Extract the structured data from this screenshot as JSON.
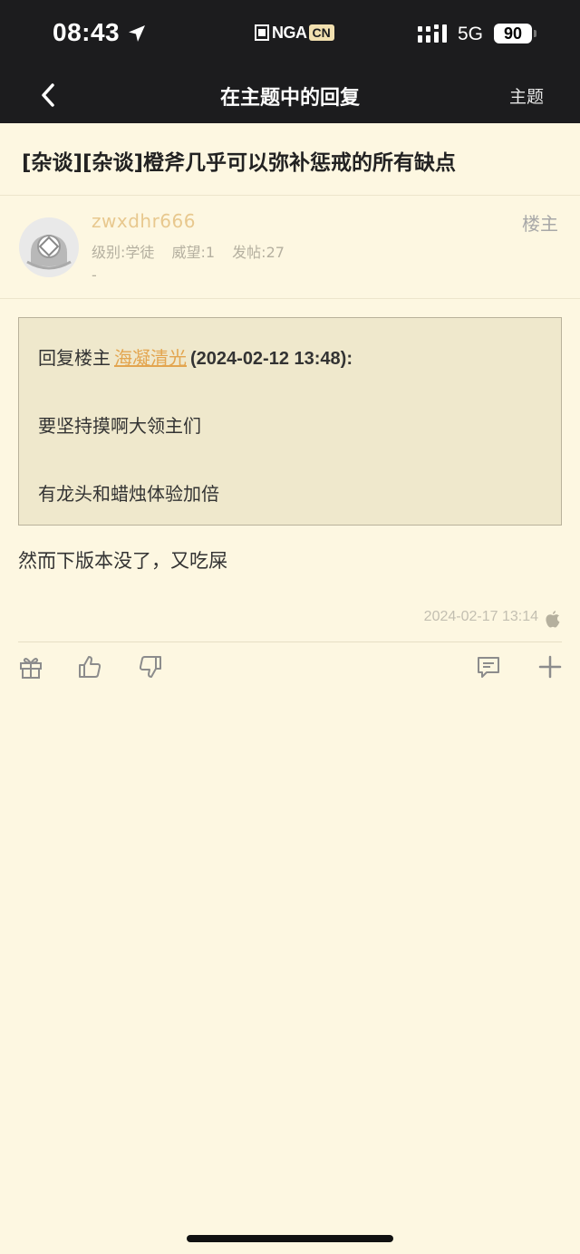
{
  "status_bar": {
    "time": "08:43",
    "network": "5G",
    "battery": "90",
    "brand": "NGA",
    "brand_suffix": "CN"
  },
  "navbar": {
    "title": "在主题中的回复",
    "topic_link": "主题"
  },
  "topic": {
    "title": "[杂谈][杂谈]橙斧几乎可以弥补惩戒的所有缺点"
  },
  "author": {
    "username": "zwxdhr666",
    "level": "级别:学徒",
    "prestige": "威望:1",
    "posts": "发帖:27",
    "signature": "-",
    "floor_tag": "楼主"
  },
  "quote": {
    "prefix": "回复楼主",
    "quoted_user": "海凝清光",
    "date": "(2024-02-12 13:48):",
    "line1": "要坚持摸啊大领主们",
    "line2": "有龙头和蜡烛体验加倍"
  },
  "post": {
    "body": "然而下版本没了，又吃屎",
    "time": "2024-02-17 13:14"
  },
  "colors": {
    "background": "#fdf7e1",
    "header": "#1c1c1e",
    "username": "#e8c88e",
    "link": "#e3a54f"
  }
}
